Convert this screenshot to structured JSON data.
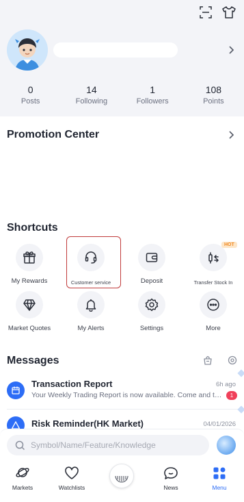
{
  "profile": {
    "stats": [
      {
        "value": "0",
        "label": "Posts"
      },
      {
        "value": "14",
        "label": "Following"
      },
      {
        "value": "1",
        "label": "Followers"
      },
      {
        "value": "108",
        "label": "Points"
      }
    ]
  },
  "promotion": {
    "title": "Promotion Center"
  },
  "shortcuts": {
    "title": "Shortcuts",
    "hot_badge": "HOT",
    "items": [
      {
        "label": "My Rewards",
        "icon": "gift-icon"
      },
      {
        "label": "Customer service",
        "icon": "headset-icon"
      },
      {
        "label": "Deposit",
        "icon": "wallet-icon"
      },
      {
        "label": "Transfer Stock In",
        "icon": "transfer-icon"
      },
      {
        "label": "Market Quotes",
        "icon": "diamond-icon"
      },
      {
        "label": "My Alerts",
        "icon": "bell-icon"
      },
      {
        "label": "Settings",
        "icon": "gear-icon"
      },
      {
        "label": "More",
        "icon": "more-icon"
      }
    ]
  },
  "messages": {
    "title": "Messages",
    "items": [
      {
        "title": "Transaction Report",
        "time": "6h ago",
        "snippet": "Your Weekly Trading Report is now available. Come and take a look!",
        "badge": "1"
      },
      {
        "title": "Risk Reminder(HK Market)",
        "time": "04/01/2026",
        "snippet": ""
      }
    ]
  },
  "search": {
    "placeholder": "Symbol/Name/Feature/Knowledge"
  },
  "tabs": [
    {
      "label": "Markets"
    },
    {
      "label": "Watchlists"
    },
    {
      "label": "News"
    },
    {
      "label": "Menu"
    }
  ],
  "colors": {
    "accent": "#2d6df6",
    "highlight": "#c03a3a",
    "hot": "#f08a24"
  }
}
